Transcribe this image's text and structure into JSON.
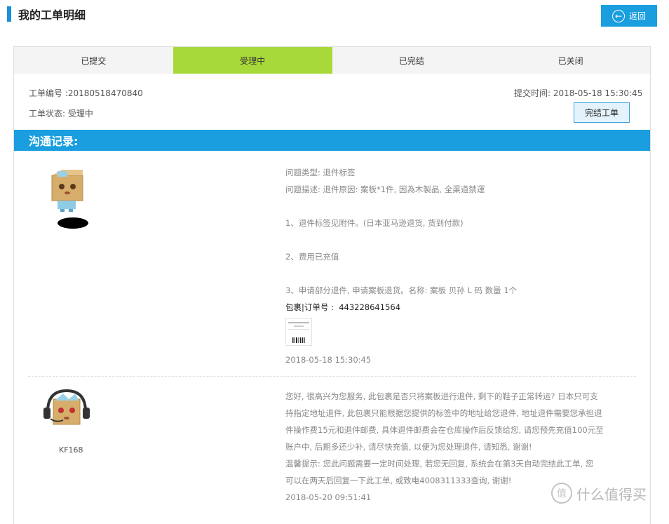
{
  "page": {
    "title": "我的工单明细",
    "back_label": "返回"
  },
  "tabs": [
    {
      "label": "已提交"
    },
    {
      "label": "受理中"
    },
    {
      "label": "已完结"
    },
    {
      "label": "已关闭"
    }
  ],
  "ticket": {
    "number_label": "工单编号 :",
    "number_value": "20180518470840",
    "status_label": "工单状态:",
    "status_value": "受理中",
    "submit_time_label": "提交时间:",
    "submit_time_value": "2018-05-18 15:30:45",
    "finish_button": "完结工单"
  },
  "communication": {
    "header": "沟通记录:",
    "messages": [
      {
        "lines": [
          "问题类型: 退件标签",
          "问题描述: 退件原因: 案板*1件, 因為木製品, 全渠道禁運",
          "",
          "1、退件标签见附件。(日本亚马逊退货, 货到付款)",
          "",
          "2、费用已充值",
          "",
          "3、申请部分退件, 申请案板退货。名称: 案板 贝孙 L 码 数量 1个"
        ],
        "parcel_label": "包裹|订单号 :",
        "parcel_value": "443228641564",
        "time": "2018-05-18 15:30:45"
      },
      {
        "user": "KF168",
        "lines": [
          "您好, 很高兴为您服务, 此包裹是否只将案板进行退件, 剩下的鞋子正常转运? 日本只可支",
          "持指定地址退件, 此包裹只能根据您提供的标签中的地址给您退件, 地址退件需要您承担退",
          "件操作费15元和退件邮费, 具体退件邮费会在仓库操作后反馈给您, 请您预先充值100元至",
          "账户中, 后期多还少补, 请尽快充值, 以便为您处理退件, 请知悉, 谢谢!",
          "温馨提示: 您此问题需要一定时间处理, 若您无回复, 系统会在第3天自动完结此工单, 您",
          "可以在两天后回复一下此工单, 或致电4008311333查询, 谢谢!"
        ],
        "time": "2018-05-20 09:51:41"
      }
    ]
  },
  "watermark": {
    "icon": "值",
    "text": "什么值得买"
  },
  "colors": {
    "accent": "#1a9ee0",
    "active_tab": "#a8d93a"
  }
}
